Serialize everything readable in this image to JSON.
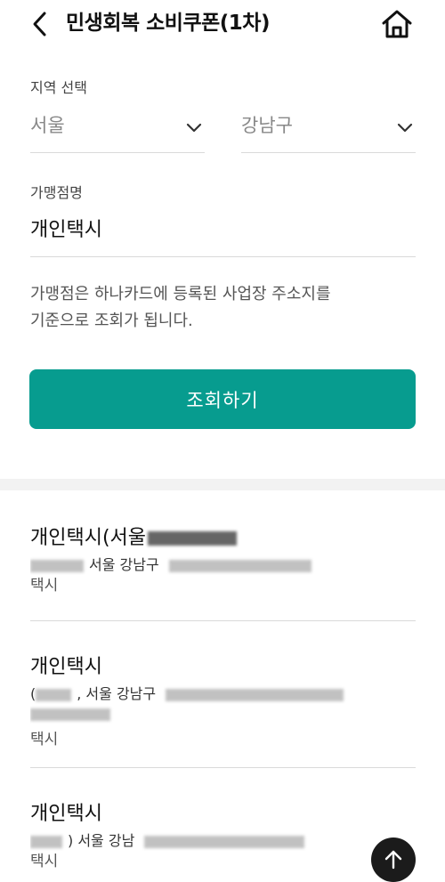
{
  "header": {
    "title": "민생회복 소비쿠폰(1차)",
    "back_icon": "chevron-left-icon",
    "home_icon": "home-icon"
  },
  "form": {
    "region_label": "지역 선택",
    "city_value": "서울",
    "district_value": "강남구",
    "merchant_label": "가맹점명",
    "merchant_value": "개인택시",
    "notice": "가맹점은 하나카드에 등록된 사업장 주소지를\n기준으로 조회가 됩니다.",
    "search_button": "조회하기"
  },
  "results": [
    {
      "name": "개인택시(서울",
      "addr": "서울 강남구",
      "category": "택시"
    },
    {
      "name": "개인택시",
      "addr": "(",
      "addr2": ", 서울 강남구",
      "category": "택시"
    },
    {
      "name": "개인택시",
      "addr": ") 서울 강남",
      "category": "택시"
    }
  ],
  "colors": {
    "accent": "#079c8f",
    "scroll_button": "#1b1b1b"
  }
}
